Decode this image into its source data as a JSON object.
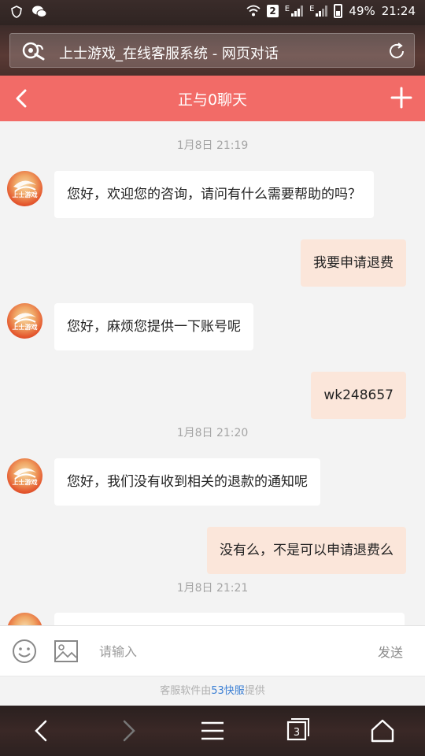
{
  "status_bar": {
    "sim_badge": "2",
    "network_label_1": "E",
    "network_label_2": "E",
    "battery": "49%",
    "time": "21:24"
  },
  "browser": {
    "page_title": "上士游戏_在线客服系统 - 网页对话"
  },
  "chat_header": {
    "title": "正与0聊天"
  },
  "avatar_text": "上士游戏",
  "messages": [
    {
      "type": "time",
      "text": "1月8日 21:19"
    },
    {
      "type": "in",
      "text": "您好，欢迎您的咨询，请问有什么需要帮助的吗？"
    },
    {
      "type": "out",
      "text": "我要申请退费"
    },
    {
      "type": "in",
      "text": "您好，麻烦您提供一下账号呢"
    },
    {
      "type": "out",
      "text": "wk248657"
    },
    {
      "type": "time",
      "text": "1月8日 21:20"
    },
    {
      "type": "in",
      "text": "您好，我们没有收到相关的退款的通知呢"
    },
    {
      "type": "out",
      "text": "没有么，不是可以申请退费么"
    },
    {
      "type": "time",
      "text": "1月8日 21:21"
    }
  ],
  "input": {
    "placeholder": "请输入",
    "send_label": "发送"
  },
  "footer": {
    "prefix": "客服软件由",
    "brand": "53快服",
    "suffix": "提供"
  },
  "nav": {
    "tab_count": "3"
  }
}
